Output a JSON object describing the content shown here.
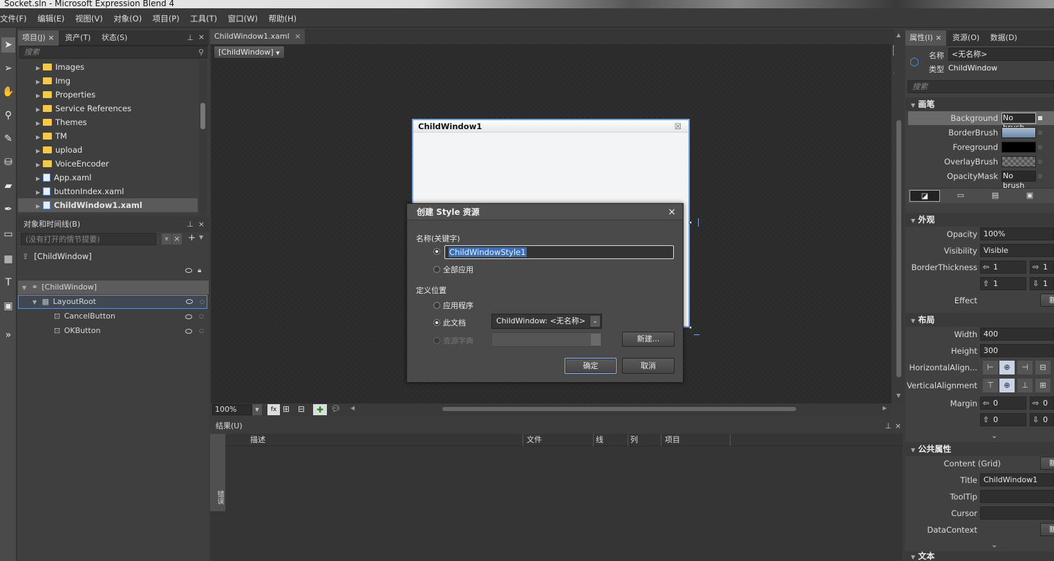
{
  "window": {
    "title": "Socket.sln - Microsoft Expression Blend 4"
  },
  "menu": [
    "文件(F)",
    "编辑(E)",
    "视图(V)",
    "对象(O)",
    "项目(P)",
    "工具(T)",
    "窗口(W)",
    "帮助(H)"
  ],
  "project_panel": {
    "tabs": [
      "项目(J)",
      "资产(T)",
      "状态(S)"
    ],
    "search_placeholder": "搜索",
    "items": [
      {
        "label": "Images",
        "type": "folder"
      },
      {
        "label": "Img",
        "type": "folder"
      },
      {
        "label": "Properties",
        "type": "folder"
      },
      {
        "label": "Service References",
        "type": "folder"
      },
      {
        "label": "Themes",
        "type": "folder"
      },
      {
        "label": "TM",
        "type": "folder"
      },
      {
        "label": "upload",
        "type": "folder"
      },
      {
        "label": "VoiceEncoder",
        "type": "folder"
      },
      {
        "label": "App.xaml",
        "type": "xaml"
      },
      {
        "label": "buttonIndex.xaml",
        "type": "xaml"
      },
      {
        "label": "ChildWindow1.xaml",
        "type": "xaml",
        "selected": true
      }
    ]
  },
  "objects_panel": {
    "title": "对象和时间线(B)",
    "storyboard_placeholder": "(没有打开的情节提要)",
    "scope": "[ChildWindow]",
    "tree": [
      {
        "label": "[ChildWindow]",
        "level": 0
      },
      {
        "label": "LayoutRoot",
        "level": 1
      },
      {
        "label": "CancelButton",
        "level": 2
      },
      {
        "label": "OKButton",
        "level": 2
      }
    ]
  },
  "document": {
    "tab": "ChildWindow1.xaml",
    "breadcrumb": "[ChildWindow]",
    "zoom": "100%",
    "child_window_title": "ChildWindow1"
  },
  "results_panel": {
    "title": "结果(U)",
    "columns": [
      "描述",
      "文件",
      "线",
      "列",
      "项目"
    ],
    "side_tab": "错误"
  },
  "dialog": {
    "title": "创建 Style 资源",
    "name_label": "名称(关键字)",
    "name_value": "ChildWindowStyle1",
    "apply_all": "全部应用",
    "define_label": "定义位置",
    "opt_app": "应用程序",
    "opt_doc": "此文档",
    "doc_combo": "ChildWindow: <无名称>",
    "opt_dict": "资源字典",
    "new_button": "新建...",
    "ok": "确定",
    "cancel": "取消"
  },
  "properties": {
    "tabs": [
      "属性(I)",
      "资源(O)",
      "数据(D)"
    ],
    "name_label": "名称",
    "name_value": "<无名称>",
    "type_label": "类型",
    "type_value": "ChildWindow",
    "search_placeholder": "搜索",
    "brushes_header": "画笔",
    "brushes": [
      {
        "label": "Background",
        "value": "No brush"
      },
      {
        "label": "BorderBrush",
        "value": ""
      },
      {
        "label": "Foreground",
        "value": ""
      },
      {
        "label": "OverlayBrush",
        "value": ""
      },
      {
        "label": "OpacityMask",
        "value": "No brush"
      }
    ],
    "appearance_header": "外观",
    "opacity_label": "Opacity",
    "opacity_value": "100%",
    "visibility_label": "Visibility",
    "visibility_value": "Visible",
    "border_label": "BorderThickness",
    "border_values": [
      "1",
      "1",
      "1",
      "1"
    ],
    "effect_label": "Effect",
    "effect_button": "新",
    "layout_header": "布局",
    "width_label": "Width",
    "width_value": "400",
    "height_label": "Height",
    "height_value": "300",
    "halign_label": "HorizontalAlign...",
    "valign_label": "VerticalAlignment",
    "margin_label": "Margin",
    "margin_values": [
      "0",
      "0",
      "0",
      "0"
    ],
    "common_header": "公共属性",
    "content_label": "Content (Grid)",
    "content_button": "新",
    "title_label": "Title",
    "title_value": "ChildWindow1",
    "tooltip_label": "ToolTip",
    "cursor_label": "Cursor",
    "datacontext_label": "DataContext",
    "datacontext_button": "新",
    "text_header": "文本"
  }
}
